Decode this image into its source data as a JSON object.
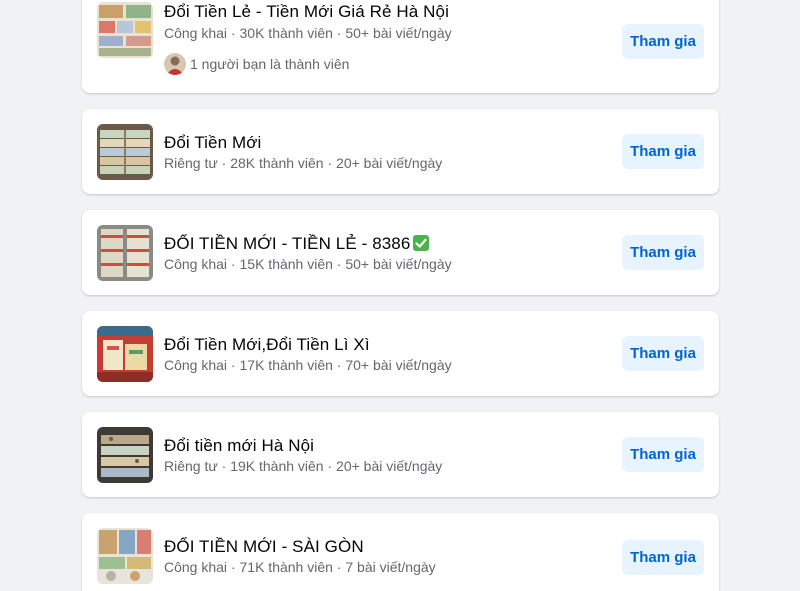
{
  "groups": [
    {
      "name": "Đổi Tiền Lẻ - Tiền Mới Giá Rẻ Hà Nội",
      "privacy": "Công khai",
      "members": "30K thành viên",
      "posts": "50+ bài viết/ngày",
      "friends_text": "1 người bạn là thành viên",
      "button": "Tham gia"
    },
    {
      "name": "Đổi Tiền Mới",
      "privacy": "Riêng tư",
      "members": "28K thành viên",
      "posts": "20+ bài viết/ngày",
      "button": "Tham gia"
    },
    {
      "name": "ĐỔI TIỀN MỚI - TIỀN LẺ - 8386",
      "privacy": "Công khai",
      "members": "15K thành viên",
      "posts": "50+ bài viết/ngày",
      "button": "Tham gia",
      "title_emoji": "check-mark-emoji"
    },
    {
      "name": "Đổi Tiền Mới,Đổi Tiền Lì Xì",
      "privacy": "Công khai",
      "members": "17K thành viên",
      "posts": "70+ bài viết/ngày",
      "button": "Tham gia"
    },
    {
      "name": "Đổi tiền mới Hà Nội",
      "privacy": "Riêng tư",
      "members": "19K thành viên",
      "posts": "20+ bài viết/ngày",
      "button": "Tham gia"
    },
    {
      "name": "ĐỔI TIỀN MỚI - SÀI GÒN",
      "privacy": "Công khai",
      "members": "71K thành viên",
      "posts": "7 bài viết/ngày",
      "button": "Tham gia"
    }
  ],
  "meta_separator": " · ",
  "colors": {
    "background": "#f0f2f5",
    "card": "#ffffff",
    "join_bg": "#e7f3ff",
    "join_text": "#0064d1",
    "secondary_text": "#65676b",
    "verified_green": "#4bb34b"
  }
}
